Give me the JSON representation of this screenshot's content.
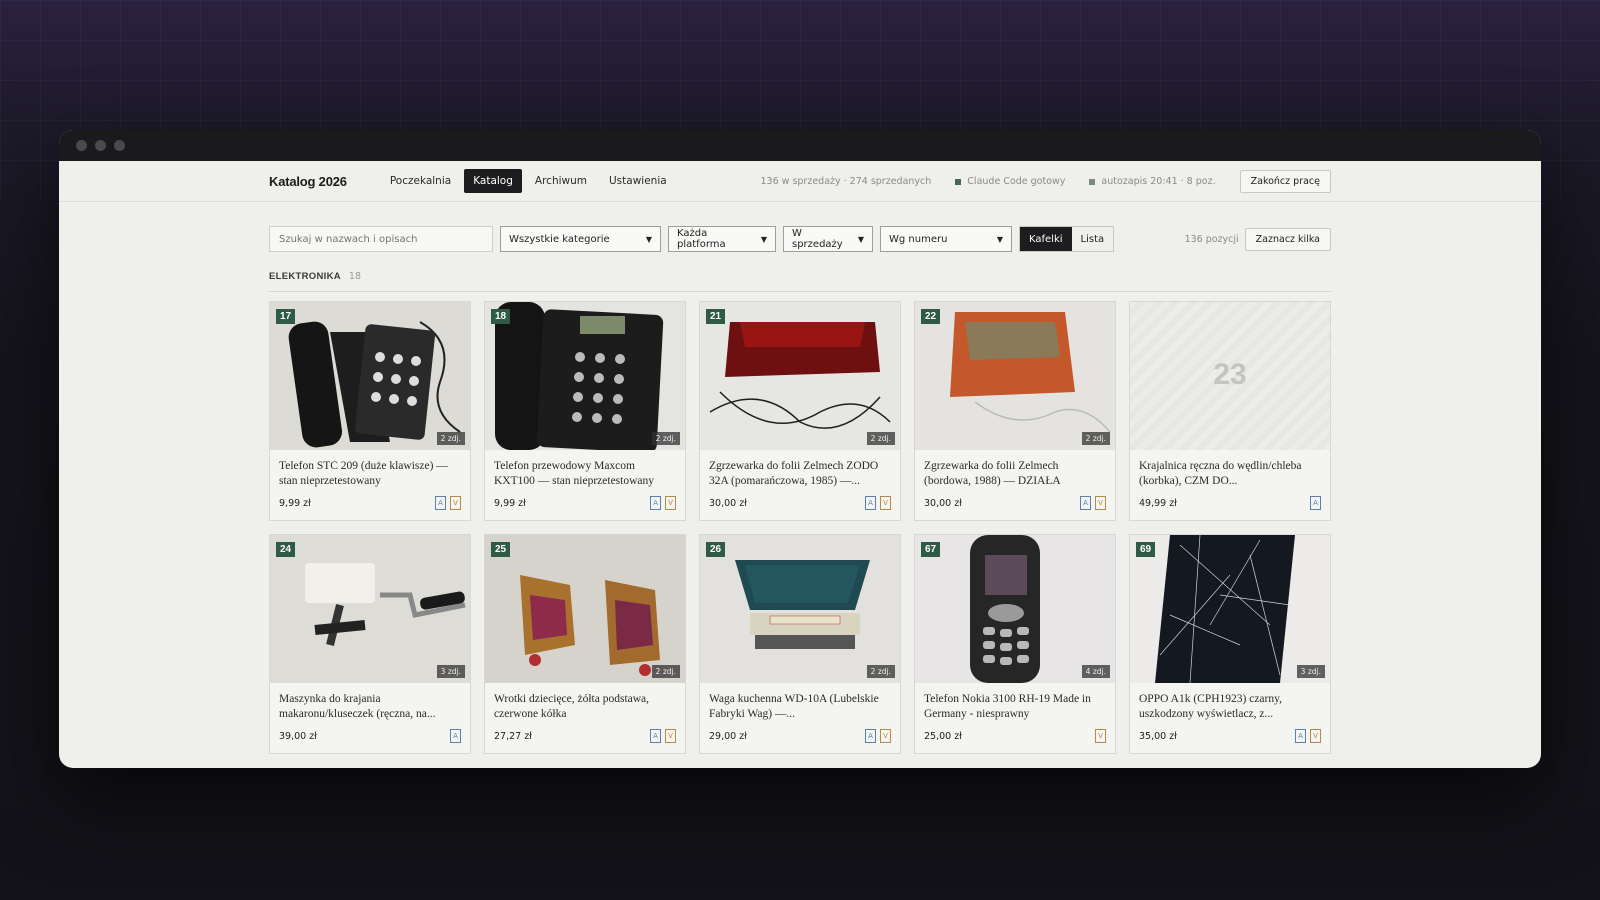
{
  "app": {
    "brand": "Katalog 2026",
    "nav": [
      "Poczekalnia",
      "Katalog",
      "Archiwum",
      "Ustawienia"
    ],
    "active_nav": "Katalog",
    "stats": "136 w sprzedaży · 274 sprzedanych",
    "status_ready": "Claude Code gotowy",
    "status_autosave": "autozapis 20:41 · 8 poz.",
    "finish_button": "Zakończ pracę"
  },
  "filters": {
    "search_placeholder": "Szukaj w nazwach i opisach",
    "category": "Wszystkie kategorie",
    "platform": "Każda platforma",
    "status": "W sprzedaży",
    "sort": "Wg numeru",
    "view_tiles": "Kafelki",
    "view_list": "Lista",
    "count": "136 pozycji",
    "select_many": "Zaznacz kilka"
  },
  "section": {
    "title": "ELEKTRONIKA",
    "count": "18"
  },
  "items": [
    {
      "num": "17",
      "photos": "2 zdj.",
      "title": "Telefon STC 209 (duże klawisze) — stan nieprzetestowany",
      "price": "9,99 zł",
      "tags": [
        "A",
        "V"
      ]
    },
    {
      "num": "18",
      "photos": "2 zdj.",
      "title": "Telefon przewodowy Maxcom KXT100 — stan nieprzetestowany",
      "price": "9,99 zł",
      "tags": [
        "A",
        "V"
      ]
    },
    {
      "num": "21",
      "photos": "2 zdj.",
      "title": "Zgrzewarka do folii Zelmech ZODO 32A (pomarańczowa, 1985) —...",
      "price": "30,00 zł",
      "tags": [
        "A",
        "V"
      ]
    },
    {
      "num": "22",
      "photos": "2 zdj.",
      "title": "Zgrzewarka do folii Zelmech (bordowa, 1988) — DZIAŁA",
      "price": "30,00 zł",
      "tags": [
        "A",
        "V"
      ]
    },
    {
      "num": "23",
      "photos": "",
      "title": "Krajalnica ręczna do wędlin/chleba (korbka), CZM DO...",
      "price": "49,99 zł",
      "tags": [
        "A"
      ]
    },
    {
      "num": "24",
      "photos": "3 zdj.",
      "title": "Maszynka do krajania makaronu/kluseczek (ręczna, na...",
      "price": "39,00 zł",
      "tags": [
        "A"
      ]
    },
    {
      "num": "25",
      "photos": "2 zdj.",
      "title": "Wrotki dziecięce, żółta podstawa, czerwone kółka",
      "price": "27,27 zł",
      "tags": [
        "A",
        "V"
      ]
    },
    {
      "num": "26",
      "photos": "2 zdj.",
      "title": "Waga kuchenna WD-10A (Lubelskie Fabryki Wag) —...",
      "price": "29,00 zł",
      "tags": [
        "A",
        "V"
      ]
    },
    {
      "num": "67",
      "photos": "4 zdj.",
      "title": "Telefon Nokia 3100 RH-19 Made in Germany - niesprawny",
      "price": "25,00 zł",
      "tags": [
        "V"
      ]
    },
    {
      "num": "69",
      "photos": "3 zdj.",
      "title": "OPPO A1k (CPH1923) czarny, uszkodzony wyświetlacz, z...",
      "price": "35,00 zł",
      "tags": [
        "A",
        "V"
      ]
    }
  ]
}
